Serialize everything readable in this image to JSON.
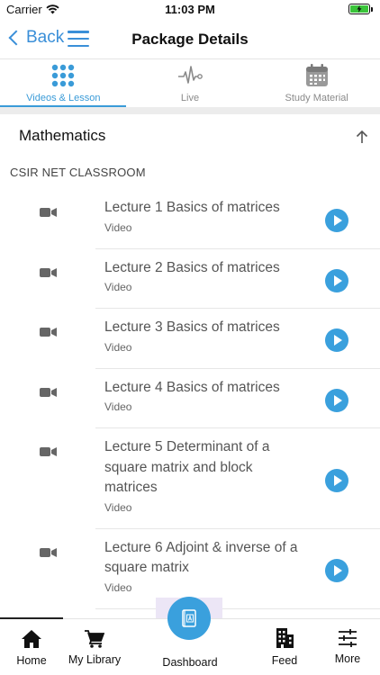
{
  "status_bar": {
    "carrier": "Carrier",
    "time": "11:03 PM"
  },
  "nav": {
    "back_label": "Back",
    "title": "Package Details"
  },
  "tabs": [
    {
      "label": "Videos & Lesson",
      "icon": "grid-dots-icon",
      "active": true
    },
    {
      "label": "Live",
      "icon": "pulse-icon",
      "active": false
    },
    {
      "label": "Study Material",
      "icon": "calendar-icon",
      "active": false
    }
  ],
  "section": {
    "title": "Mathematics",
    "subheading": "CSIR NET CLASSROOM"
  },
  "lectures": [
    {
      "title": "Lecture 1 Basics of matrices",
      "type": "Video"
    },
    {
      "title": "Lecture 2 Basics of matrices",
      "type": "Video"
    },
    {
      "title": "Lecture 3 Basics of matrices",
      "type": "Video"
    },
    {
      "title": "Lecture 4 Basics of matrices",
      "type": "Video"
    },
    {
      "title": "Lecture 5 Determinant of a square matrix and block matrices",
      "type": "Video"
    },
    {
      "title": "Lecture 6 Adjoint & inverse of a square matrix",
      "type": "Video"
    }
  ],
  "bottom_tabs": [
    {
      "label": "Home",
      "icon": "home-icon"
    },
    {
      "label": "My Library",
      "icon": "cart-icon"
    },
    {
      "label": "Dashboard",
      "icon": "book-icon"
    },
    {
      "label": "Feed",
      "icon": "building-icon"
    },
    {
      "label": "More",
      "icon": "sliders-icon"
    }
  ],
  "colors": {
    "accent": "#3aa0dd",
    "nav_blue": "#3a8fd8"
  }
}
